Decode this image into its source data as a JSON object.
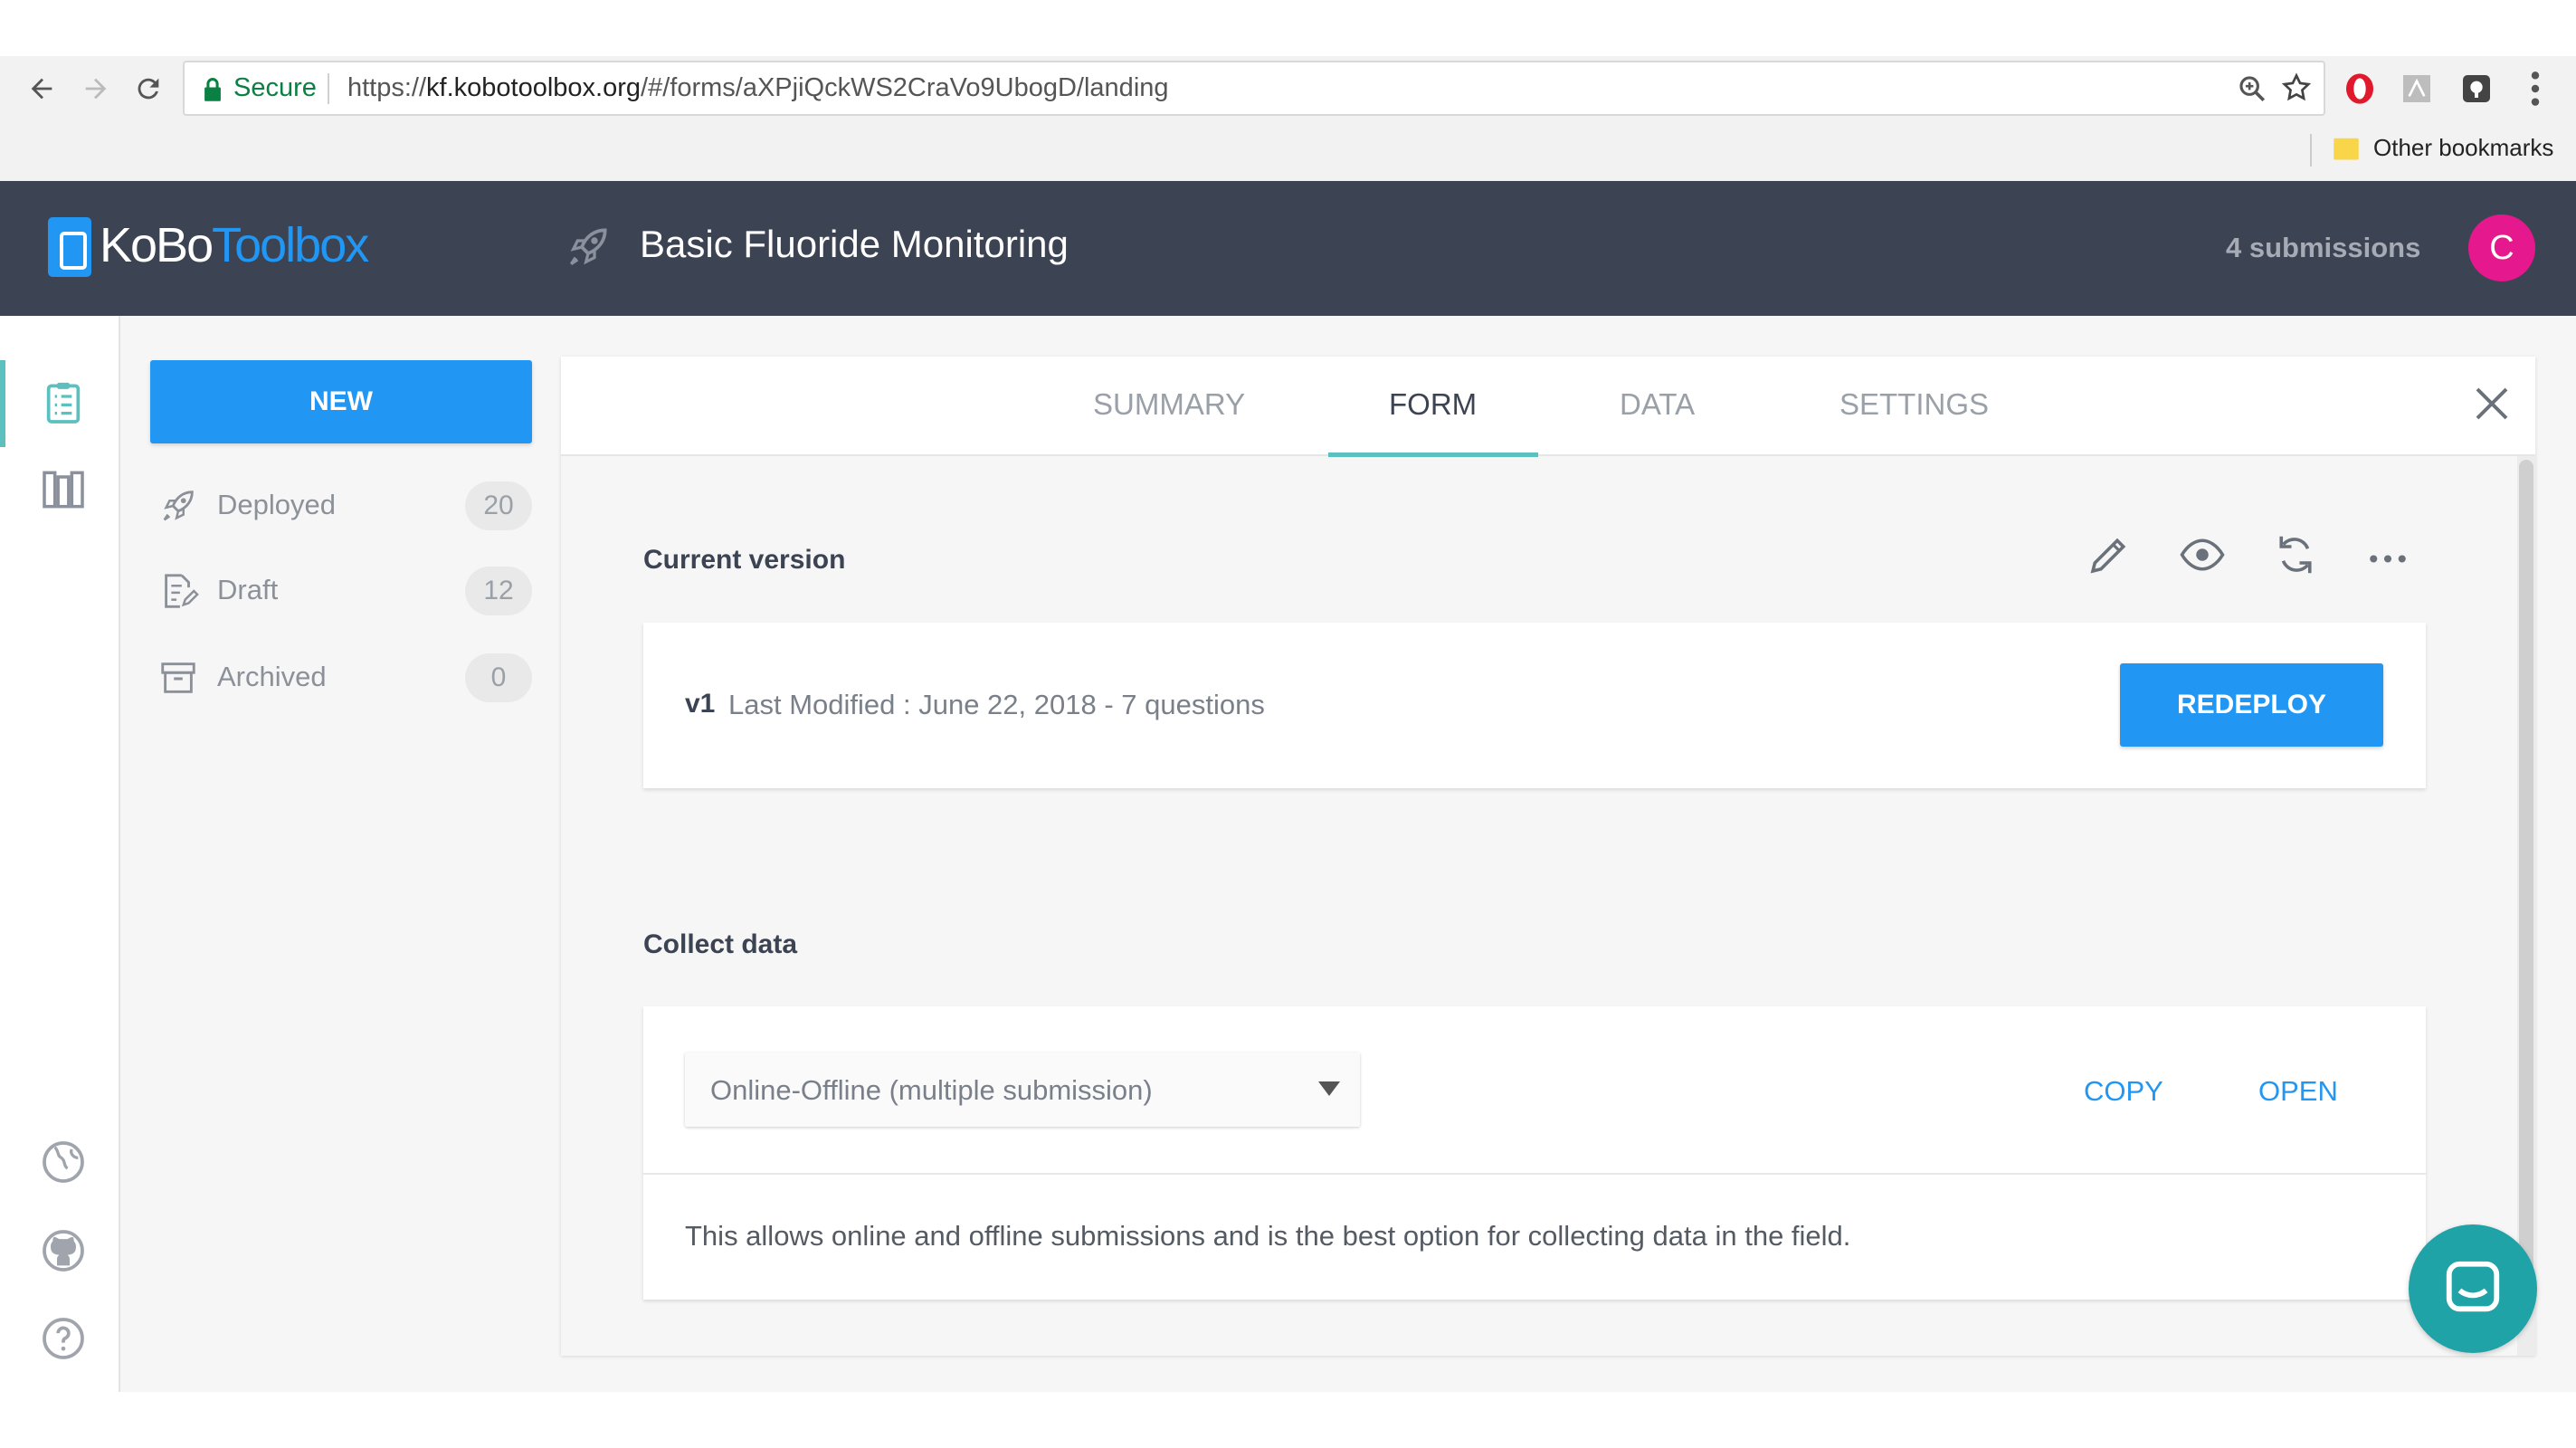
{
  "browser": {
    "secure_label": "Secure",
    "url_prefix": "https://",
    "url_host": "kf.kobotoolbox.org",
    "url_path": "/#/forms/aXPjiQckWS2CraVo9UbogD/landing",
    "bookmarks_label": "Other bookmarks"
  },
  "header": {
    "logo_kobo": "KoBo",
    "logo_toolbox": "Toolbox",
    "project_title": "Basic Fluoride Monitoring",
    "submissions": "4 submissions",
    "avatar_initial": "C"
  },
  "sidebar": {
    "new_label": "NEW",
    "items": [
      {
        "label": "Deployed",
        "count": "20",
        "icon": "rocket-icon"
      },
      {
        "label": "Draft",
        "count": "12",
        "icon": "draft-icon"
      },
      {
        "label": "Archived",
        "count": "0",
        "icon": "archive-icon"
      }
    ]
  },
  "tabs": [
    {
      "label": "SUMMARY",
      "active": false
    },
    {
      "label": "FORM",
      "active": true
    },
    {
      "label": "DATA",
      "active": false
    },
    {
      "label": "SETTINGS",
      "active": false
    }
  ],
  "current_version": {
    "title": "Current version",
    "version": "v1",
    "info": "Last Modified : June 22, 2018 - 7 questions",
    "redeploy_label": "REDEPLOY",
    "actions": [
      "pencil-icon",
      "eye-icon",
      "refresh-icon",
      "more-icon"
    ]
  },
  "collect_data": {
    "title": "Collect data",
    "selected_option": "Online-Offline (multiple submission)",
    "copy_label": "COPY",
    "open_label": "OPEN",
    "description": "This allows online and offline submissions and is the best option for collecting data in the field."
  },
  "colors": {
    "header_bg": "#3c4353",
    "primary": "#2196f3",
    "accent_teal": "#5bc0be",
    "avatar": "#e6188d",
    "chat": "#1fa3a7"
  }
}
